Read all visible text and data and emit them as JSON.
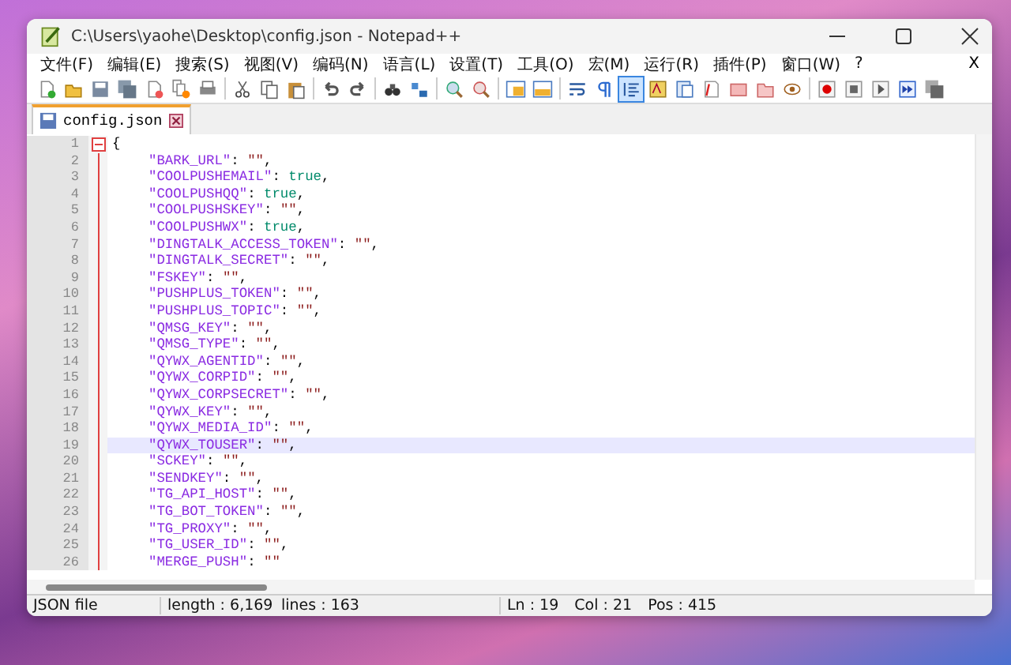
{
  "window": {
    "title": "C:\\Users\\yaohe\\Desktop\\config.json - Notepad++"
  },
  "menu": [
    {
      "label": "文件(F)"
    },
    {
      "label": "编辑(E)"
    },
    {
      "label": "搜索(S)"
    },
    {
      "label": "视图(V)"
    },
    {
      "label": "编码(N)"
    },
    {
      "label": "语言(L)"
    },
    {
      "label": "设置(T)"
    },
    {
      "label": "工具(O)"
    },
    {
      "label": "宏(M)"
    },
    {
      "label": "运行(R)"
    },
    {
      "label": "插件(P)"
    },
    {
      "label": "窗口(W)"
    },
    {
      "label": "?"
    }
  ],
  "menu_close": "X",
  "toolbar": [
    {
      "kind": "new",
      "pressed": false
    },
    {
      "kind": "open",
      "pressed": false
    },
    {
      "kind": "save",
      "pressed": false
    },
    {
      "kind": "save-all",
      "pressed": false
    },
    {
      "kind": "close",
      "pressed": false
    },
    {
      "kind": "close-all",
      "pressed": false
    },
    {
      "kind": "print",
      "pressed": false
    },
    {
      "kind": "sep"
    },
    {
      "kind": "cut",
      "pressed": false
    },
    {
      "kind": "copy",
      "pressed": false
    },
    {
      "kind": "paste",
      "pressed": false
    },
    {
      "kind": "sep"
    },
    {
      "kind": "undo",
      "pressed": false
    },
    {
      "kind": "redo",
      "pressed": false
    },
    {
      "kind": "sep"
    },
    {
      "kind": "find",
      "pressed": false
    },
    {
      "kind": "replace",
      "pressed": false
    },
    {
      "kind": "sep"
    },
    {
      "kind": "zoom-in",
      "pressed": false
    },
    {
      "kind": "zoom-out",
      "pressed": false
    },
    {
      "kind": "sep"
    },
    {
      "kind": "sync-v",
      "pressed": false
    },
    {
      "kind": "sync-h",
      "pressed": false
    },
    {
      "kind": "sep"
    },
    {
      "kind": "wrap",
      "pressed": false
    },
    {
      "kind": "pilcrow",
      "pressed": false
    },
    {
      "kind": "indent",
      "pressed": true
    },
    {
      "kind": "udl",
      "pressed": false
    },
    {
      "kind": "chart",
      "pressed": false
    },
    {
      "kind": "docs",
      "pressed": false
    },
    {
      "kind": "function",
      "pressed": false
    },
    {
      "kind": "folder",
      "pressed": false
    },
    {
      "kind": "eye",
      "pressed": false
    },
    {
      "kind": "sep"
    },
    {
      "kind": "record",
      "pressed": false
    },
    {
      "kind": "stop",
      "pressed": false
    },
    {
      "kind": "play",
      "pressed": false
    },
    {
      "kind": "play-multi",
      "pressed": false
    },
    {
      "kind": "save-macro",
      "pressed": false
    }
  ],
  "tabs": [
    {
      "label": "config.json",
      "selected": true
    }
  ],
  "editor": {
    "lines": [
      {
        "number": "1",
        "selected": false,
        "fold": true,
        "tokens": [
          {
            "t": "{",
            "kind": "punct"
          }
        ]
      },
      {
        "number": "2",
        "selected": false,
        "fold": false,
        "tokens": [
          {
            "t": "\"BARK_URL\"",
            "kind": "key"
          },
          {
            "t": ": ",
            "kind": "punct"
          },
          {
            "t": "\"\"",
            "kind": "string"
          },
          {
            "t": ",",
            "kind": "punct"
          }
        ]
      },
      {
        "number": "3",
        "selected": false,
        "fold": false,
        "tokens": [
          {
            "t": "\"COOLPUSHEMAIL\"",
            "kind": "key"
          },
          {
            "t": ": ",
            "kind": "punct"
          },
          {
            "t": "true",
            "kind": "bool"
          },
          {
            "t": ",",
            "kind": "punct"
          }
        ]
      },
      {
        "number": "4",
        "selected": false,
        "fold": false,
        "tokens": [
          {
            "t": "\"COOLPUSHQQ\"",
            "kind": "key"
          },
          {
            "t": ": ",
            "kind": "punct"
          },
          {
            "t": "true",
            "kind": "bool"
          },
          {
            "t": ",",
            "kind": "punct"
          }
        ]
      },
      {
        "number": "5",
        "selected": false,
        "fold": false,
        "tokens": [
          {
            "t": "\"COOLPUSHSKEY\"",
            "kind": "key"
          },
          {
            "t": ": ",
            "kind": "punct"
          },
          {
            "t": "\"\"",
            "kind": "string"
          },
          {
            "t": ",",
            "kind": "punct"
          }
        ]
      },
      {
        "number": "6",
        "selected": false,
        "fold": false,
        "tokens": [
          {
            "t": "\"COOLPUSHWX\"",
            "kind": "key"
          },
          {
            "t": ": ",
            "kind": "punct"
          },
          {
            "t": "true",
            "kind": "bool"
          },
          {
            "t": ",",
            "kind": "punct"
          }
        ]
      },
      {
        "number": "7",
        "selected": false,
        "fold": false,
        "tokens": [
          {
            "t": "\"DINGTALK_ACCESS_TOKEN\"",
            "kind": "key"
          },
          {
            "t": ": ",
            "kind": "punct"
          },
          {
            "t": "\"\"",
            "kind": "string"
          },
          {
            "t": ",",
            "kind": "punct"
          }
        ]
      },
      {
        "number": "8",
        "selected": false,
        "fold": false,
        "tokens": [
          {
            "t": "\"DINGTALK_SECRET\"",
            "kind": "key"
          },
          {
            "t": ": ",
            "kind": "punct"
          },
          {
            "t": "\"\"",
            "kind": "string"
          },
          {
            "t": ",",
            "kind": "punct"
          }
        ]
      },
      {
        "number": "9",
        "selected": false,
        "fold": false,
        "tokens": [
          {
            "t": "\"FSKEY\"",
            "kind": "key"
          },
          {
            "t": ": ",
            "kind": "punct"
          },
          {
            "t": "\"\"",
            "kind": "string"
          },
          {
            "t": ",",
            "kind": "punct"
          }
        ]
      },
      {
        "number": "10",
        "selected": false,
        "fold": false,
        "tokens": [
          {
            "t": "\"PUSHPLUS_TOKEN\"",
            "kind": "key"
          },
          {
            "t": ": ",
            "kind": "punct"
          },
          {
            "t": "\"\"",
            "kind": "string"
          },
          {
            "t": ",",
            "kind": "punct"
          }
        ]
      },
      {
        "number": "11",
        "selected": false,
        "fold": false,
        "tokens": [
          {
            "t": "\"PUSHPLUS_TOPIC\"",
            "kind": "key"
          },
          {
            "t": ": ",
            "kind": "punct"
          },
          {
            "t": "\"\"",
            "kind": "string"
          },
          {
            "t": ",",
            "kind": "punct"
          }
        ]
      },
      {
        "number": "12",
        "selected": false,
        "fold": false,
        "tokens": [
          {
            "t": "\"QMSG_KEY\"",
            "kind": "key"
          },
          {
            "t": ": ",
            "kind": "punct"
          },
          {
            "t": "\"\"",
            "kind": "string"
          },
          {
            "t": ",",
            "kind": "punct"
          }
        ]
      },
      {
        "number": "13",
        "selected": false,
        "fold": false,
        "tokens": [
          {
            "t": "\"QMSG_TYPE\"",
            "kind": "key"
          },
          {
            "t": ": ",
            "kind": "punct"
          },
          {
            "t": "\"\"",
            "kind": "string"
          },
          {
            "t": ",",
            "kind": "punct"
          }
        ]
      },
      {
        "number": "14",
        "selected": false,
        "fold": false,
        "tokens": [
          {
            "t": "\"QYWX_AGENTID\"",
            "kind": "key"
          },
          {
            "t": ": ",
            "kind": "punct"
          },
          {
            "t": "\"\"",
            "kind": "string"
          },
          {
            "t": ",",
            "kind": "punct"
          }
        ]
      },
      {
        "number": "15",
        "selected": false,
        "fold": false,
        "tokens": [
          {
            "t": "\"QYWX_CORPID\"",
            "kind": "key"
          },
          {
            "t": ": ",
            "kind": "punct"
          },
          {
            "t": "\"\"",
            "kind": "string"
          },
          {
            "t": ",",
            "kind": "punct"
          }
        ]
      },
      {
        "number": "16",
        "selected": false,
        "fold": false,
        "tokens": [
          {
            "t": "\"QYWX_CORPSECRET\"",
            "kind": "key"
          },
          {
            "t": ": ",
            "kind": "punct"
          },
          {
            "t": "\"\"",
            "kind": "string"
          },
          {
            "t": ",",
            "kind": "punct"
          }
        ]
      },
      {
        "number": "17",
        "selected": false,
        "fold": false,
        "tokens": [
          {
            "t": "\"QYWX_KEY\"",
            "kind": "key"
          },
          {
            "t": ": ",
            "kind": "punct"
          },
          {
            "t": "\"\"",
            "kind": "string"
          },
          {
            "t": ",",
            "kind": "punct"
          }
        ]
      },
      {
        "number": "18",
        "selected": false,
        "fold": false,
        "tokens": [
          {
            "t": "\"QYWX_MEDIA_ID\"",
            "kind": "key"
          },
          {
            "t": ": ",
            "kind": "punct"
          },
          {
            "t": "\"\"",
            "kind": "string"
          },
          {
            "t": ",",
            "kind": "punct"
          }
        ]
      },
      {
        "number": "19",
        "selected": true,
        "fold": false,
        "tokens": [
          {
            "t": "\"QYWX_TOUSER\"",
            "kind": "key"
          },
          {
            "t": ": ",
            "kind": "punct"
          },
          {
            "t": "\"\"",
            "kind": "string"
          },
          {
            "t": ",",
            "kind": "punct"
          }
        ]
      },
      {
        "number": "20",
        "selected": false,
        "fold": false,
        "tokens": [
          {
            "t": "\"SCKEY\"",
            "kind": "key"
          },
          {
            "t": ": ",
            "kind": "punct"
          },
          {
            "t": "\"\"",
            "kind": "string"
          },
          {
            "t": ",",
            "kind": "punct"
          }
        ]
      },
      {
        "number": "21",
        "selected": false,
        "fold": false,
        "tokens": [
          {
            "t": "\"SENDKEY\"",
            "kind": "key"
          },
          {
            "t": ": ",
            "kind": "punct"
          },
          {
            "t": "\"\"",
            "kind": "string"
          },
          {
            "t": ",",
            "kind": "punct"
          }
        ]
      },
      {
        "number": "22",
        "selected": false,
        "fold": false,
        "tokens": [
          {
            "t": "\"TG_API_HOST\"",
            "kind": "key"
          },
          {
            "t": ": ",
            "kind": "punct"
          },
          {
            "t": "\"\"",
            "kind": "string"
          },
          {
            "t": ",",
            "kind": "punct"
          }
        ]
      },
      {
        "number": "23",
        "selected": false,
        "fold": false,
        "tokens": [
          {
            "t": "\"TG_BOT_TOKEN\"",
            "kind": "key"
          },
          {
            "t": ": ",
            "kind": "punct"
          },
          {
            "t": "\"\"",
            "kind": "string"
          },
          {
            "t": ",",
            "kind": "punct"
          }
        ]
      },
      {
        "number": "24",
        "selected": false,
        "fold": false,
        "tokens": [
          {
            "t": "\"TG_PROXY\"",
            "kind": "key"
          },
          {
            "t": ": ",
            "kind": "punct"
          },
          {
            "t": "\"\"",
            "kind": "string"
          },
          {
            "t": ",",
            "kind": "punct"
          }
        ]
      },
      {
        "number": "25",
        "selected": false,
        "fold": false,
        "tokens": [
          {
            "t": "\"TG_USER_ID\"",
            "kind": "key"
          },
          {
            "t": ": ",
            "kind": "punct"
          },
          {
            "t": "\"\"",
            "kind": "string"
          },
          {
            "t": ",",
            "kind": "punct"
          }
        ]
      },
      {
        "number": "26",
        "selected": false,
        "fold": false,
        "tokens": [
          {
            "t": "\"MERGE_PUSH\"",
            "kind": "key"
          },
          {
            "t": ": ",
            "kind": "punct"
          },
          {
            "t": "\"\"",
            "kind": "string"
          }
        ]
      }
    ]
  },
  "status_bar": {
    "file_type": "JSON file",
    "length": "length : 6,169",
    "lines": "lines : 163",
    "ln": "Ln : 19",
    "col": "Col : 21",
    "pos": "Pos : 415"
  }
}
